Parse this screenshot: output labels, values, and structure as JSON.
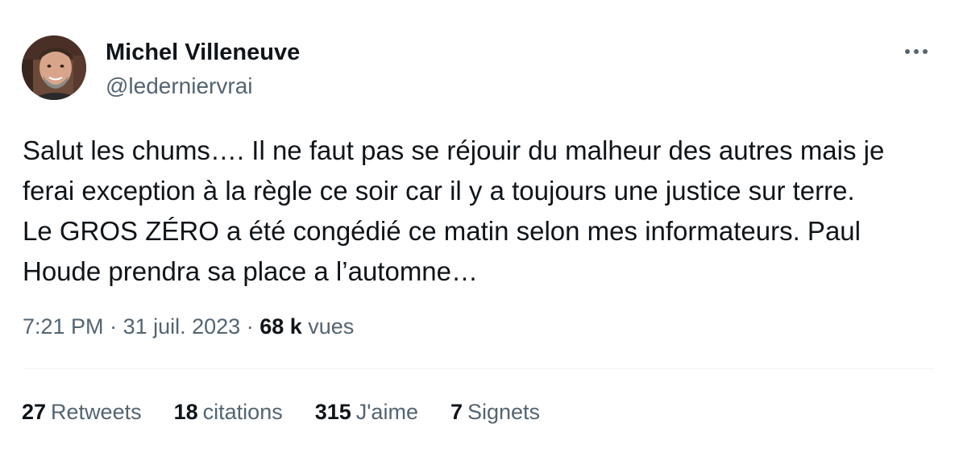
{
  "author": {
    "name": "Michel Villeneuve",
    "handle": "@ledernier​vrai",
    "avatar_icon": "profile-photo"
  },
  "more_icon": "ellipsis-icon",
  "tweet": {
    "lines": [
      "Salut les chums…. Il ne faut pas se réjouir du malheur des autres mais je",
      "ferai exception à la règle ce soir car il y a toujours une justice sur terre.",
      "Le GROS ZÉRO a été congédié ce matin selon mes informateurs.  Paul",
      "Houde prendra sa place a l’automne…"
    ]
  },
  "meta": {
    "time": "7:21 PM",
    "separator": " · ",
    "date": "31 juil. 2023",
    "views_count": "68 k",
    "views_label": "vues"
  },
  "stats": {
    "retweets": {
      "count": "27",
      "label": "Retweets"
    },
    "quotes": {
      "count": "18",
      "label": "citations"
    },
    "likes": {
      "count": "315",
      "label": "J'aime"
    },
    "bookmarks": {
      "count": "7",
      "label": "Signets"
    }
  },
  "colors": {
    "text": "#0f1419",
    "secondary": "#536471",
    "divider": "#eff3f4"
  }
}
